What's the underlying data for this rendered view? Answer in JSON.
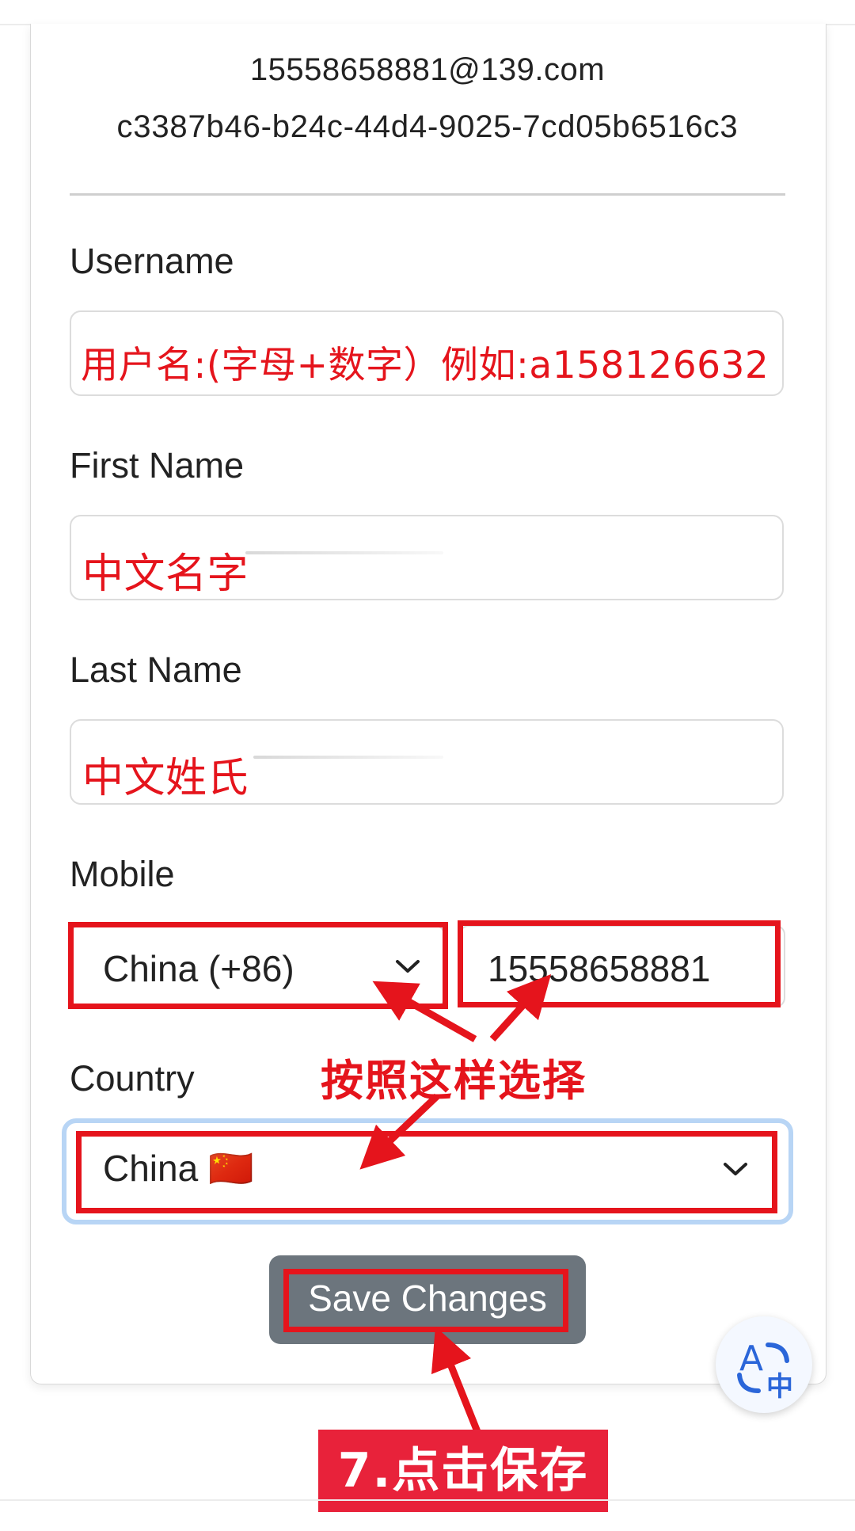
{
  "profile": {
    "email": "15558658881@139.com",
    "user_id": "c3387b46-b24c-44d4-9025-7cd05b6516c3"
  },
  "form": {
    "username_label": "Username",
    "username_value": "用户名:(字母+数字）例如:a158126632",
    "first_name_label": "First Name",
    "first_name_value": "中文名字",
    "last_name_label": "Last Name",
    "last_name_value": "中文姓氏",
    "mobile_label": "Mobile",
    "mobile_country_code": "China (+86)",
    "mobile_number": "15558658881",
    "country_label": "Country",
    "country_value": "China 🇨🇳",
    "save_label": "Save Changes"
  },
  "annotations": {
    "select_instruction": "按照这样选择",
    "step_label": "7.点击保存",
    "highlight_color": "#e5141c"
  },
  "colors": {
    "save_button": "#6c757d",
    "focus_ring": "#b8d5f5"
  },
  "icons": {
    "dropdown": "chevron-down-icon",
    "translate": "translate-icon"
  }
}
